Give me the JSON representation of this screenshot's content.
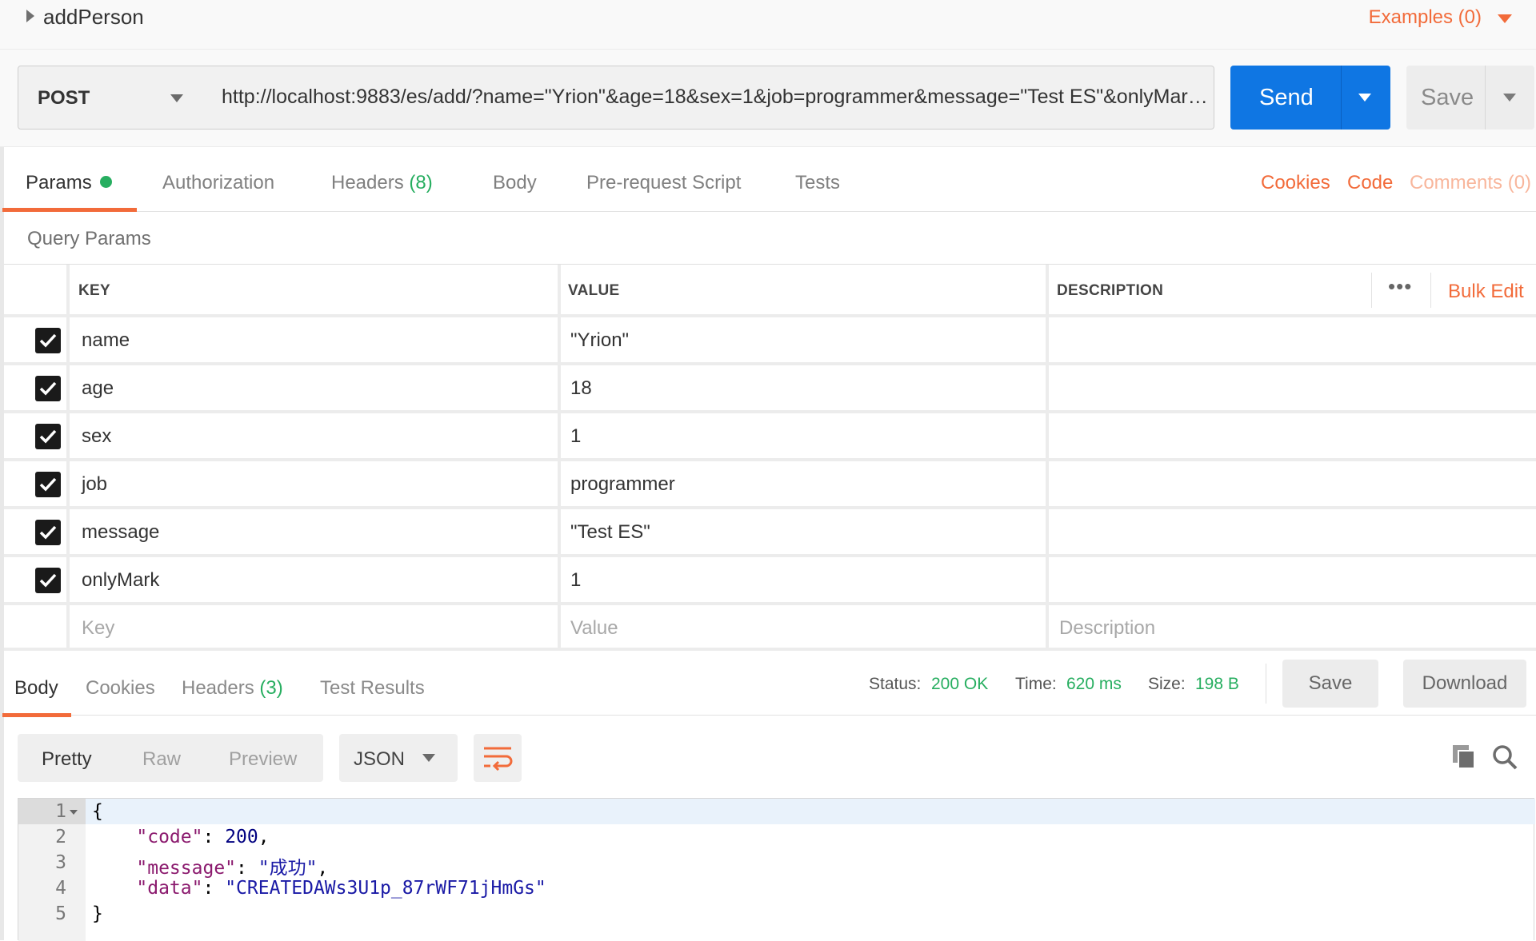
{
  "request": {
    "name": "addPerson",
    "examples_label": "Examples (0)",
    "method": "POST",
    "url": "http://localhost:9883/es/add/?name=\"Yrion\"&age=18&sex=1&job=programmer&message=\"Test ES\"&onlyMark=1",
    "send_label": "Send",
    "save_label": "Save"
  },
  "tabs": {
    "params": "Params",
    "authorization": "Authorization",
    "headers": "Headers",
    "headers_count": "(8)",
    "body": "Body",
    "prerequest": "Pre-request Script",
    "tests": "Tests",
    "cookies": "Cookies",
    "code": "Code",
    "comments": "Comments (0)"
  },
  "params": {
    "title": "Query Params",
    "headers": {
      "key": "KEY",
      "value": "VALUE",
      "description": "DESCRIPTION"
    },
    "more_icon": "ellipsis-icon",
    "bulk_edit": "Bulk Edit",
    "rows": [
      {
        "checked": true,
        "key": "name",
        "value": "\"Yrion\""
      },
      {
        "checked": true,
        "key": "age",
        "value": "18"
      },
      {
        "checked": true,
        "key": "sex",
        "value": "1"
      },
      {
        "checked": true,
        "key": "job",
        "value": "programmer"
      },
      {
        "checked": true,
        "key": "message",
        "value": "\"Test ES\""
      },
      {
        "checked": true,
        "key": "onlyMark",
        "value": "1"
      }
    ],
    "placeholder": {
      "key": "Key",
      "value": "Value",
      "description": "Description"
    }
  },
  "response": {
    "tabs": {
      "body": "Body",
      "cookies": "Cookies",
      "headers": "Headers",
      "headers_count": "(3)",
      "tests": "Test Results"
    },
    "status_label": "Status:",
    "status": "200 OK",
    "time_label": "Time:",
    "time": "620 ms",
    "size_label": "Size:",
    "size": "198 B",
    "save_label": "Save",
    "download_label": "Download",
    "view": {
      "pretty": "Pretty",
      "raw": "Raw",
      "preview": "Preview"
    },
    "format": "JSON",
    "code_lines": [
      {
        "num": "1",
        "text": "{"
      },
      {
        "num": "2",
        "key": "\"code\"",
        "sep": ": ",
        "val": "200",
        "end": ","
      },
      {
        "num": "3",
        "key": "\"message\"",
        "sep": ": ",
        "val": "\"成功\"",
        "end": ","
      },
      {
        "num": "4",
        "key": "\"data\"",
        "sep": ": ",
        "val": "\"CREATEDAWs3U1p_87rWF71jHmGs\"",
        "end": ""
      },
      {
        "num": "5",
        "text": "}"
      }
    ]
  },
  "colors": {
    "accent": "#f26b3a",
    "send_blue": "#0f76e3",
    "status_green": "#27ae60"
  }
}
